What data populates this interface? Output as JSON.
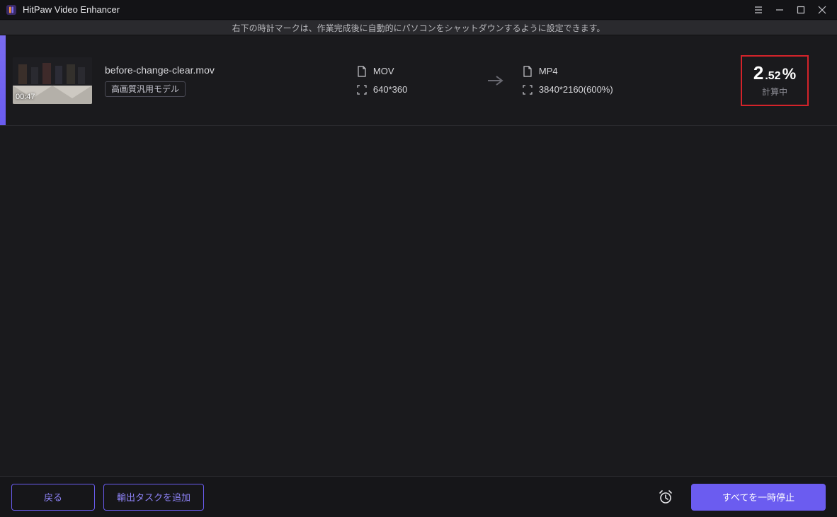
{
  "window": {
    "title": "HitPaw Video Enhancer"
  },
  "infobar": {
    "text": "右下の時計マークは、作業完成後に自動的にパソコンをシャットダウンするように設定できます。"
  },
  "task": {
    "filename": "before-change-clear.mov",
    "model": "高画質汎用モデル",
    "duration": "00:47",
    "source": {
      "format": "MOV",
      "resolution": "640*360"
    },
    "target": {
      "format": "MP4",
      "resolution": "3840*2160(600%)"
    },
    "progress": {
      "int": "2",
      "dec": ".52",
      "percent": "%",
      "status": "計算中"
    }
  },
  "footer": {
    "back": "戻る",
    "add_export_task": "輸出タスクを追加",
    "pause_all": "すべてを一時停止"
  }
}
